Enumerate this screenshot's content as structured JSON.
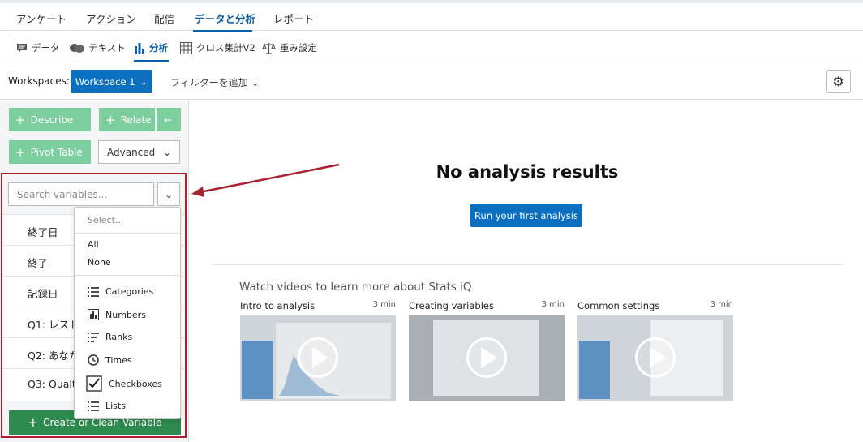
{
  "topnav": {
    "tabs": [
      "アンケート",
      "アクション",
      "配信",
      "データと分析",
      "レポート"
    ],
    "active_index": 3
  },
  "subnav": {
    "tabs": [
      {
        "label": "データ",
        "icon": "comment-icon"
      },
      {
        "label": "テキスト",
        "icon": "chat-bubbles-icon"
      },
      {
        "label": "分析",
        "icon": "bar-chart-icon"
      },
      {
        "label": "クロス集計V2",
        "icon": "table-grid-icon"
      },
      {
        "label": "重み設定",
        "icon": "scale-icon"
      }
    ],
    "active_index": 2
  },
  "workspace": {
    "label": "Workspaces:",
    "button": "Workspace 1",
    "filter": "フィルターを追加"
  },
  "left": {
    "describe": "Describe",
    "relate": "Relate",
    "back_arrow": "←",
    "pivot": "Pivot Table",
    "advanced": "Advanced",
    "search_placeholder": "Search variables...",
    "variables": [
      "終了日",
      "終了",
      "記録日",
      "Q1: レスト",
      "Q2: あなた",
      "Q3: Qualtr"
    ],
    "create": "Create or Clean Variable"
  },
  "dropdown": {
    "select": "Select...",
    "all": "All",
    "none": "None",
    "types": [
      {
        "label": "Categories",
        "icon": "list-icon"
      },
      {
        "label": "Numbers",
        "icon": "bar-chart-icon"
      },
      {
        "label": "Ranks",
        "icon": "ranked-list-icon"
      },
      {
        "label": "Times",
        "icon": "clock-icon"
      },
      {
        "label": "Checkboxes",
        "icon": "checkbox-icon"
      },
      {
        "label": "Lists",
        "icon": "list-icon"
      }
    ]
  },
  "main": {
    "title": "No analysis results",
    "run_button": "Run your first analysis",
    "videos_heading": "Watch videos to learn more about Stats iQ",
    "videos": [
      {
        "title": "Intro to analysis",
        "duration": "3 min"
      },
      {
        "title": "Creating variables",
        "duration": "3 min"
      },
      {
        "title": "Common settings",
        "duration": "3 min"
      }
    ]
  },
  "colors": {
    "accent": "#0b6fc0",
    "green_light": "#7ccf9c",
    "green_dark": "#2e8b4f",
    "highlight_red": "#b01e2e"
  }
}
